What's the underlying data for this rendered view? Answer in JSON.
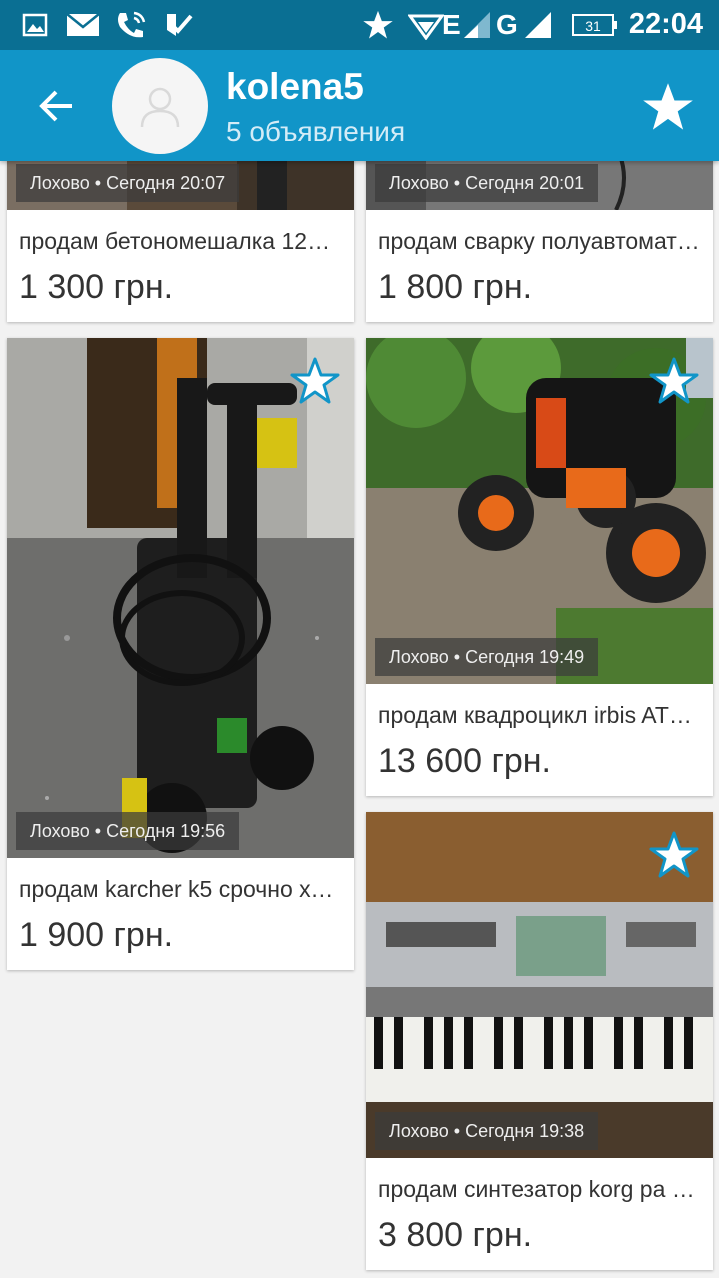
{
  "status_bar": {
    "time": "22:04",
    "battery": "31",
    "network_e": "E",
    "network_g": "G",
    "icons": [
      "image-icon",
      "mail-icon",
      "phone-wifi-icon",
      "checkmark-app-icon",
      "star-icon",
      "wifi-icon",
      "signal-icon",
      "signal-icon",
      "battery-icon"
    ]
  },
  "header": {
    "username": "kolena5",
    "ads_count": "5 объявления",
    "icons": [
      "back-arrow-icon",
      "avatar-placeholder-icon",
      "favorite-star-icon"
    ]
  },
  "listings": [
    {
      "location": "Лохово • Сегодня 20:07",
      "title": "продам бетономешалка 120…",
      "price": "1 300 грн."
    },
    {
      "location": "Лохово • Сегодня 20:01",
      "title": "продам сварку полуавтомат…",
      "price": "1 800 грн."
    },
    {
      "location": "Лохово • Сегодня 19:56",
      "title": "продам karcher k5 срочно хо…",
      "price": "1 900 грн."
    },
    {
      "location": "Лохово • Сегодня 19:49",
      "title": "продам квадроцикл irbis AT…",
      "price": "13 600 грн."
    },
    {
      "location": "Лохово • Сегодня 19:38",
      "title": "продам синтезатор korg pa 5…",
      "price": "3 800 грн."
    }
  ],
  "colors": {
    "status_bar": "#0a6f93",
    "app_bar": "#1195c8",
    "background": "#f2f2f2",
    "star": "#1195c8"
  }
}
